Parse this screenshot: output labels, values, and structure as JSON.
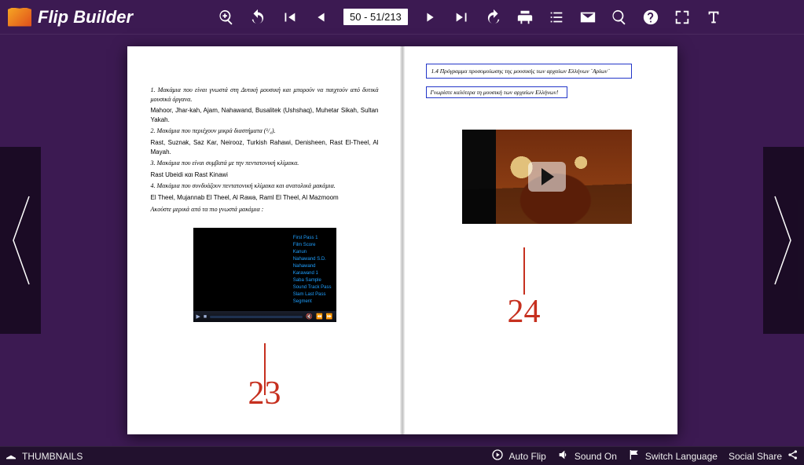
{
  "brand": "Flip Builder",
  "pageCounter": "50 - 51/213",
  "leftPage": {
    "lines": [
      {
        "style": "para",
        "text": "1. Μακάμια που είναι γνωστά στη Δυτική μουσική και μπορούν να παιχτούν από δυτικά μουσικά όργανα."
      },
      {
        "style": "para noit",
        "text": "Mahoor, Jhar-kah, Ajam, Nahawand, Busalitek (Ushshaq), Muhetar Sikah, Sultan Yakah."
      },
      {
        "style": "para",
        "text": "2. Μακάμια που περιέχουν μικρά διαστήματα (¹/₄)."
      },
      {
        "style": "para noit",
        "text": "Rast, Suznak, Saz Kar, Neirooz, Turkish Rahawi, Denisheen, Rast El-Theel, Al Mayah."
      },
      {
        "style": "para",
        "text": "3. Μακάμια που είναι συμβατά με την πεντατονική κλίμακα."
      },
      {
        "style": "para noit",
        "text": "Rast Ubeidi και Rast Kinawi"
      },
      {
        "style": "para",
        "text": "4. Μακάμια που συνδυάζουν πεντατονική κλίμακα και ανατολικά μακάμια."
      },
      {
        "style": "para noit",
        "text": "El Theel, Mujannab El Theel, Al Rawa, Raml El Theel, Al Mazmoom"
      },
      {
        "style": "para",
        "text": "Ακούστε μερικά από τα πιο γνωστά μακάμια :"
      }
    ],
    "tracks": [
      "First Pass 1",
      "Film Score",
      "Kanun",
      "Nahawand S.D.",
      "Nahawand",
      "Karawand 1",
      "Saba Sample",
      "Sound Track Pass",
      "Slam Last Pass",
      "Segment"
    ],
    "pageNumber": "23"
  },
  "rightPage": {
    "box1": "1.4 Πρόγραμμα προσομοίωσης της μουσικής των αρχαίων Ελλήνων ¨Αρίων¨",
    "box2": "Γνωρίστε καλύτερα τη μουσική των αρχαίων Ελλήνων!",
    "pageNumber": "24"
  },
  "footer": {
    "thumbnails": "THUMBNAILS",
    "autoFlip": "Auto Flip",
    "soundOn": "Sound On",
    "switchLang": "Switch Language",
    "socialShare": "Social Share"
  }
}
